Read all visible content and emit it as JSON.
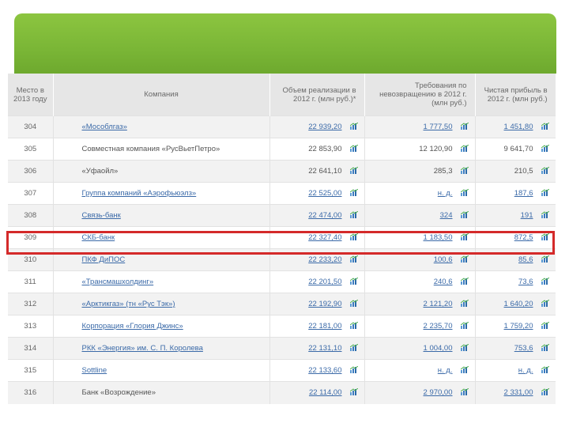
{
  "header": {
    "col_rank": "Место в 2013 году",
    "col_company": "Компания",
    "col_sales": "Объем реализации в 2012 г. (млн руб.)*",
    "col_debt": "Требования по невозвращению в 2012 г. (млн руб.)",
    "col_profit": "Чистая прибыль в 2012 г. (млн руб.)"
  },
  "icons": {
    "chart": "chart-icon"
  },
  "colors": {
    "banner": "#7ab636",
    "highlight": "#d42a2a",
    "link": "#3b6aa8"
  },
  "rows": [
    {
      "rank": "304",
      "company": "«Мособлгаз»",
      "sales": "22 939,20",
      "debt": "1 777,50",
      "profit": "1 451,80"
    },
    {
      "rank": "305",
      "company": "Совместная компания «РусВьетПетро»",
      "sales": "22 853,90",
      "debt": "12 120,90",
      "profit": "9 641,70"
    },
    {
      "rank": "306",
      "company": "«Уфаойл»",
      "sales": "22 641,10",
      "debt": "285,3",
      "profit": "210,5"
    },
    {
      "rank": "307",
      "company": "Группа компаний «Аэрофьюэлз»",
      "sales": "22 525,00",
      "debt": "н. д.",
      "profit": "187,6"
    },
    {
      "rank": "308",
      "company": "Связь-банк",
      "sales": "22 474,00",
      "debt": "324",
      "profit": "191"
    },
    {
      "rank": "309",
      "company": "СКБ-банк",
      "sales": "22 327,40",
      "debt": "1 183,50",
      "profit": "872,5"
    },
    {
      "rank": "310",
      "company": "ПКФ ДиПОС",
      "sales": "22 233,20",
      "debt": "100,6",
      "profit": "85,6"
    },
    {
      "rank": "311",
      "company": "«Трансмашхолдинг»",
      "sales": "22 201,50",
      "debt": "240,6",
      "profit": "73,6"
    },
    {
      "rank": "312",
      "company": "«Арктикгаз» (тн «Рус Тэк»)",
      "sales": "22 192,90",
      "debt": "2 121,20",
      "profit": "1 640,20"
    },
    {
      "rank": "313",
      "company": "Корпорация «Глория Джинс»",
      "sales": "22 181,00",
      "debt": "2 235,70",
      "profit": "1 759,20"
    },
    {
      "rank": "314",
      "company": "РКК «Энергия» им. С. П. Королева",
      "sales": "22 131,10",
      "debt": "1 004,00",
      "profit": "753,6"
    },
    {
      "rank": "315",
      "company": "Sottline",
      "sales": "22 133,60",
      "debt": "н. д.",
      "profit": "н. д."
    },
    {
      "rank": "316",
      "company": "Банк «Возрождение»",
      "sales": "22 114,00",
      "debt": "2 970,00",
      "profit": "2 331,00"
    }
  ]
}
